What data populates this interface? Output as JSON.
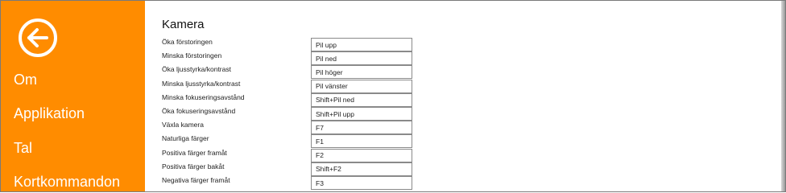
{
  "sidebar": {
    "nav": [
      "Om",
      "Applikation",
      "Tal",
      "Kortkommandon"
    ]
  },
  "section": {
    "title": "Kamera"
  },
  "shortcuts": [
    {
      "label": "Öka förstoringen",
      "value": "Pil upp"
    },
    {
      "label": "Minska förstoringen",
      "value": "Pil ned"
    },
    {
      "label": "Öka ljusstyrka/kontrast",
      "value": "Pil höger"
    },
    {
      "label": "Minska ljusstyrka/kontrast",
      "value": "Pil vänster"
    },
    {
      "label": "Minska fokuseringsavstånd",
      "value": "Shift+Pil ned"
    },
    {
      "label": "Öka fokuseringsavstånd",
      "value": "Shift+Pil upp"
    },
    {
      "label": "Växla kamera",
      "value": "F7"
    },
    {
      "label": "Naturliga färger",
      "value": "F1"
    },
    {
      "label": "Positiva färger framåt",
      "value": "F2"
    },
    {
      "label": "Positiva färger bakåt",
      "value": "Shift+F2"
    },
    {
      "label": "Negativa färger framåt",
      "value": "F3"
    }
  ]
}
